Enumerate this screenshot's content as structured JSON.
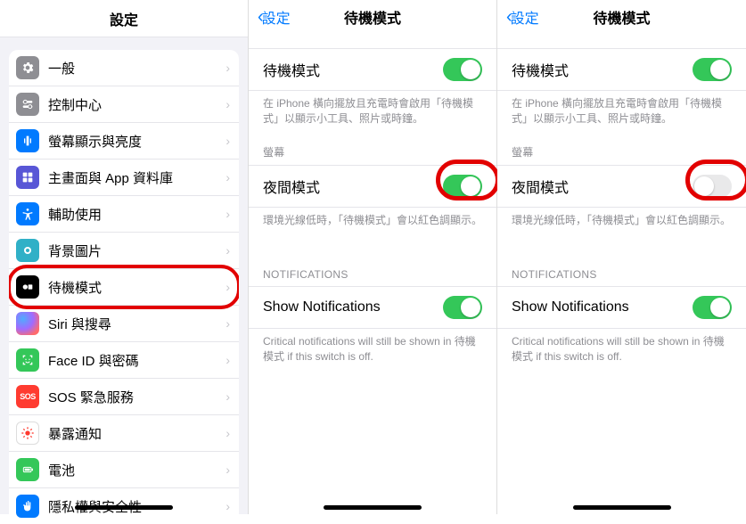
{
  "settings_title": "設定",
  "standby_title": "待機模式",
  "back_label": "設定",
  "settings_items": [
    {
      "label": "一般",
      "icon": "gear"
    },
    {
      "label": "控制中心",
      "icon": "switches"
    },
    {
      "label": "螢幕顯示與亮度",
      "icon": "brightness"
    },
    {
      "label": "主畫面與 App 資料庫",
      "icon": "grid"
    },
    {
      "label": "輔助使用",
      "icon": "accessibility"
    },
    {
      "label": "背景圖片",
      "icon": "wallpaper"
    },
    {
      "label": "待機模式",
      "icon": "standby",
      "highlight": true
    },
    {
      "label": "Siri 與搜尋",
      "icon": "siri"
    },
    {
      "label": "Face ID 與密碼",
      "icon": "faceid"
    },
    {
      "label": "SOS 緊急服務",
      "icon": "sos"
    },
    {
      "label": "暴露通知",
      "icon": "exposure"
    },
    {
      "label": "電池",
      "icon": "battery"
    },
    {
      "label": "隱私權與安全性",
      "icon": "privacy"
    }
  ],
  "standby": {
    "toggle_label": "待機模式",
    "toggle_note": "在 iPhone 橫向擺放且充電時會啟用「待機模式」以顯示小工具、照片或時鐘。",
    "display_header": "螢幕",
    "night_label": "夜間模式",
    "night_note": "環境光線低時，「待機模式」會以紅色調顯示。",
    "notif_header": "NOTIFICATIONS",
    "notif_label": "Show Notifications",
    "notif_note": "Critical notifications will still be shown in 待機模式 if this switch is off."
  },
  "panel_b_night_on": true,
  "panel_c_night_on": false
}
